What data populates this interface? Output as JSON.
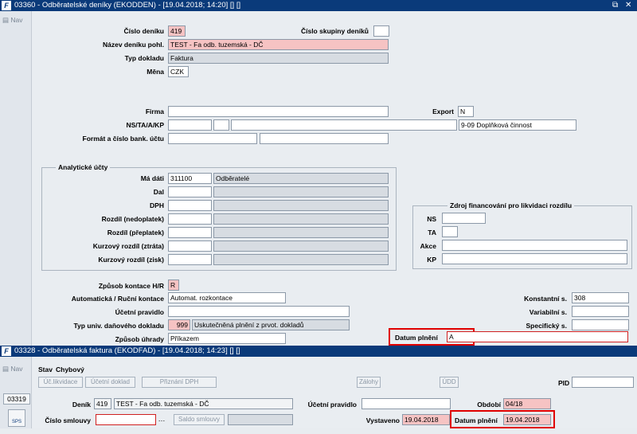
{
  "window1": {
    "title": "03360 - Odběratelské deníky (EKODDEN) - [19.04.2018; 14:20] [] []",
    "nav": "Nav",
    "restore_icon": "restore-icon",
    "close_icon": "close-icon",
    "fields": {
      "cislo_deniku": {
        "label": "Číslo deníku",
        "value": "419"
      },
      "cislo_skupiny": {
        "label": "Číslo skupiny deníků",
        "value": ""
      },
      "nazev_deniku": {
        "label": "Název deníku pohl.",
        "value": "TEST - Fa odb. tuzemská - DČ"
      },
      "typ_dokladu": {
        "label": "Typ dokladu",
        "value": "Faktura"
      },
      "mena": {
        "label": "Měna",
        "value": "CZK"
      },
      "firma": {
        "label": "Firma",
        "value": ""
      },
      "export": {
        "label": "Export",
        "value": "N"
      },
      "ns_ta": {
        "label": "NS/TA/A/KP",
        "value4": "9-09 Doplňková činnost"
      },
      "format": {
        "label": "Formát a číslo bank. účtu"
      },
      "analyticke": {
        "title": "Analytické účty",
        "ma_dati": {
          "label": "Má dáti",
          "code": "311100",
          "name": "Odběratelé"
        },
        "dal": "Dal",
        "dph": "DPH",
        "rozdil_ned": "Rozdíl (nedoplatek)",
        "rozdil_pre": "Rozdíl (přeplatek)",
        "kurz_ztrata": "Kurzový rozdíl (ztráta)",
        "kurz_zisk": "Kurzový rozdíl (zisk)"
      },
      "zdroj": {
        "title": "Zdroj financování pro likvidaci rozdílu",
        "ns": "NS",
        "ta": "TA",
        "akce": "Akce",
        "kp": "KP"
      },
      "zpusob_kontace": {
        "label": "Způsob kontace H/R",
        "value": "R"
      },
      "auto_rucni": {
        "label": "Automatická / Ruční kontace",
        "value": "Automat. rozkontace"
      },
      "ucetni_pravidlo": {
        "label": "Účetní pravidlo"
      },
      "typ_univ": {
        "label": "Typ univ. daňového dokladu",
        "code": "999",
        "name": "Uskutečněná plnění z prvot. dokladů"
      },
      "zpusob_uhrady": {
        "label": "Způsob úhrady",
        "value": "Příkazem"
      },
      "konstantni": {
        "label": "Konstantní s.",
        "value": "308"
      },
      "variabilni": {
        "label": "Variabilní s."
      },
      "specificky": {
        "label": "Specifický s."
      },
      "datum_plneni": {
        "label": "Datum plnění",
        "value": "A"
      }
    }
  },
  "window2": {
    "title": "03328 - Odběratelská faktura (EKODFAD) - [19.04.2018; 14:23] [] []",
    "nav": "Nav",
    "side_code": "03319",
    "side_icon_label": "SPS",
    "stav": "Stav",
    "chybovy": "Chybový",
    "buttons": {
      "uc_likvidace": "Úč.likvidace",
      "ucetni_doklad": "Účetní doklad",
      "priznani_dph": "Přiznání DPH",
      "zalohy": "Zálohy",
      "udd": "ÚDD"
    },
    "pid": {
      "label": "PID",
      "value": ""
    },
    "denik": {
      "label": "Deník",
      "code": "419",
      "name": "TEST - Fa odb. tuzemská - DČ"
    },
    "ucetni_pravidlo": {
      "label": "Účetní pravidlo"
    },
    "obdobi": {
      "label": "Období",
      "value": "04/18"
    },
    "cislo_smlouvy": {
      "label": "Číslo smlouvy",
      "value": ""
    },
    "saldo_smlouvy": "Saldo smlouvy",
    "vystaveno": {
      "label": "Vystaveno",
      "value": "19.04.2018"
    },
    "datum_plneni": {
      "label": "Datum plnění",
      "value": "19.04.2018"
    }
  }
}
